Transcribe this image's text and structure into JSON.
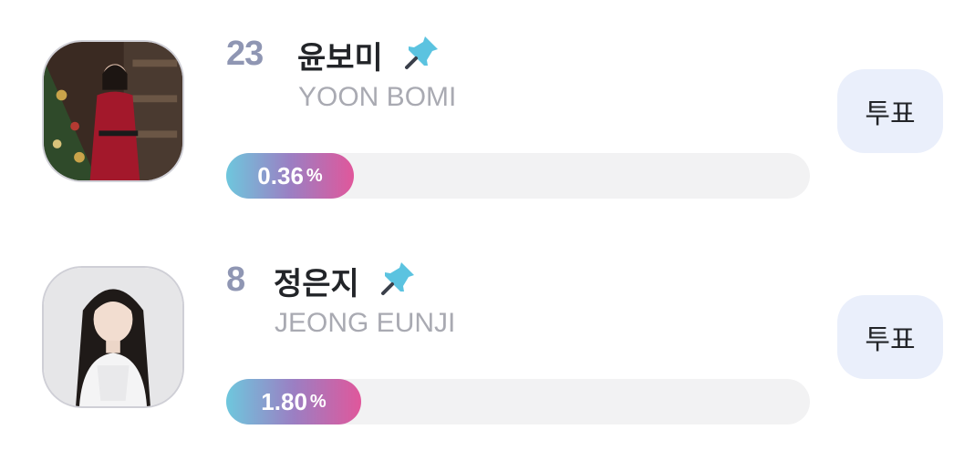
{
  "ranking": [
    {
      "rank": "23",
      "name_ko": "윤보미",
      "name_en": "YOON BOMI",
      "percent": "0.36",
      "percent_sign": "%",
      "vote_label": "투표",
      "pin_icon": "pin-icon"
    },
    {
      "rank": "8",
      "name_ko": "정은지",
      "name_en": "JEONG EUNJI",
      "percent": "1.80",
      "percent_sign": "%",
      "vote_label": "투표",
      "pin_icon": "pin-icon"
    }
  ],
  "colors": {
    "rank": "#8f96b3",
    "bar_start": "#6ec7dd",
    "bar_end": "#e0579b",
    "vote_bg": "#eaeffb",
    "pin": "#5bc3e0"
  }
}
